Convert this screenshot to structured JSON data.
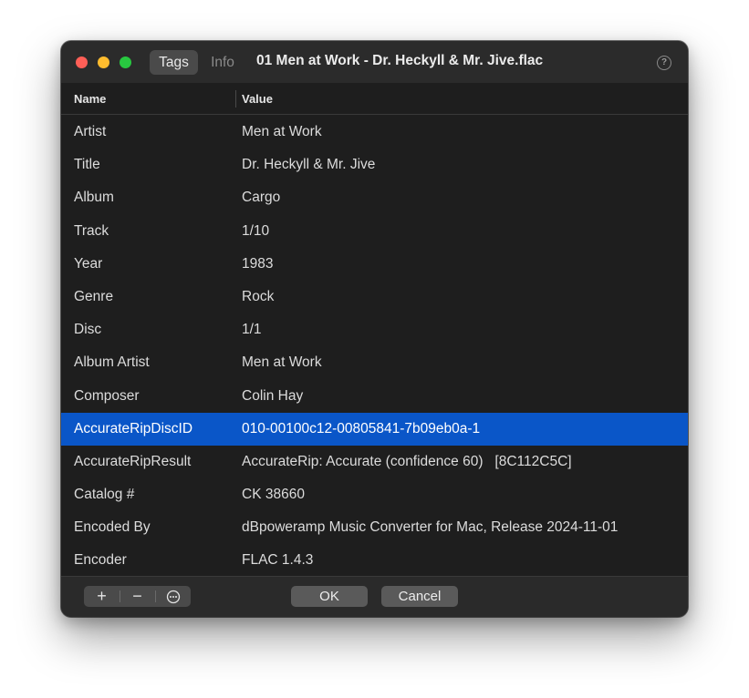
{
  "window": {
    "tabs": [
      {
        "label": "Tags",
        "selected": true
      },
      {
        "label": "Info",
        "selected": false
      }
    ],
    "title": "01 Men at Work - Dr. Heckyll & Mr. Jive.flac",
    "help_glyph": "?"
  },
  "table": {
    "columns": {
      "name": "Name",
      "value": "Value"
    },
    "rows": [
      {
        "name": "Artist",
        "value": "Men at Work"
      },
      {
        "name": "Title",
        "value": "Dr. Heckyll & Mr. Jive"
      },
      {
        "name": "Album",
        "value": "Cargo"
      },
      {
        "name": "Track",
        "value": "1/10"
      },
      {
        "name": "Year",
        "value": "1983"
      },
      {
        "name": "Genre",
        "value": "Rock"
      },
      {
        "name": "Disc",
        "value": "1/1"
      },
      {
        "name": "Album Artist",
        "value": "Men at Work"
      },
      {
        "name": "Composer",
        "value": "Colin Hay"
      },
      {
        "name": "AccurateRipDiscID",
        "value": "010-00100c12-00805841-7b09eb0a-1",
        "selected": true
      },
      {
        "name": "AccurateRipResult",
        "value": "AccurateRip: Accurate (confidence 60)   [8C112C5C]"
      },
      {
        "name": "Catalog #",
        "value": "CK 38660"
      },
      {
        "name": "Encoded By",
        "value": "dBpoweramp Music Converter for Mac, Release 2024-11-01"
      },
      {
        "name": "Encoder",
        "value": "FLAC 1.4.3"
      }
    ]
  },
  "footer": {
    "add_glyph": "+",
    "remove_glyph": "−",
    "more_glyph": "⊙",
    "ok_label": "OK",
    "cancel_label": "Cancel"
  },
  "colors": {
    "selection": "#0a56c8",
    "close": "#ff5f57",
    "minimize": "#febc2e",
    "zoom": "#28c840"
  },
  "icons": [
    "close-window-icon",
    "minimize-window-icon",
    "zoom-window-icon",
    "help-icon",
    "plus-icon",
    "minus-icon",
    "more-options-icon"
  ]
}
